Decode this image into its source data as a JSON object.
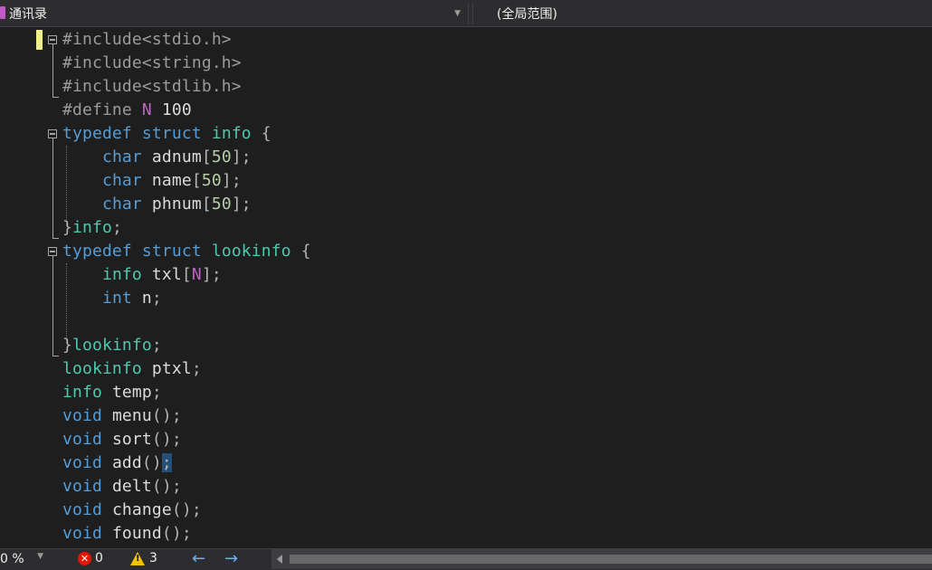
{
  "navbar": {
    "project": "通讯录",
    "scope": "(全局范围)"
  },
  "editor": {
    "lines": [
      [
        {
          "t": "#include",
          "c": "pp"
        },
        {
          "t": "<stdio.h>",
          "c": "pp"
        }
      ],
      [
        {
          "t": "#include",
          "c": "pp"
        },
        {
          "t": "<string.h>",
          "c": "pp"
        }
      ],
      [
        {
          "t": "#include",
          "c": "pp"
        },
        {
          "t": "<stdlib.h>",
          "c": "pp"
        }
      ],
      [
        {
          "t": "#define ",
          "c": "pp"
        },
        {
          "t": "N",
          "c": "mc"
        },
        {
          "t": " 100",
          "c": "pl"
        }
      ],
      [
        {
          "t": "typedef",
          "c": "kw"
        },
        {
          "t": " ",
          "c": "pl"
        },
        {
          "t": "struct",
          "c": "kw"
        },
        {
          "t": " ",
          "c": "pl"
        },
        {
          "t": "info",
          "c": "ty"
        },
        {
          "t": " {",
          "c": "pu"
        }
      ],
      [
        {
          "t": "    ",
          "c": "pl"
        },
        {
          "t": "char",
          "c": "kw"
        },
        {
          "t": " adnum",
          "c": "pl"
        },
        {
          "t": "[",
          "c": "pu"
        },
        {
          "t": "50",
          "c": "num"
        },
        {
          "t": "];",
          "c": "pu"
        }
      ],
      [
        {
          "t": "    ",
          "c": "pl"
        },
        {
          "t": "char",
          "c": "kw"
        },
        {
          "t": " name",
          "c": "pl"
        },
        {
          "t": "[",
          "c": "pu"
        },
        {
          "t": "50",
          "c": "num"
        },
        {
          "t": "];",
          "c": "pu"
        }
      ],
      [
        {
          "t": "    ",
          "c": "pl"
        },
        {
          "t": "char",
          "c": "kw"
        },
        {
          "t": " phnum",
          "c": "pl"
        },
        {
          "t": "[",
          "c": "pu"
        },
        {
          "t": "50",
          "c": "num"
        },
        {
          "t": "];",
          "c": "pu"
        }
      ],
      [
        {
          "t": "}",
          "c": "pu"
        },
        {
          "t": "info",
          "c": "ty"
        },
        {
          "t": ";",
          "c": "pu"
        }
      ],
      [
        {
          "t": "typedef",
          "c": "kw"
        },
        {
          "t": " ",
          "c": "pl"
        },
        {
          "t": "struct",
          "c": "kw"
        },
        {
          "t": " ",
          "c": "pl"
        },
        {
          "t": "lookinfo",
          "c": "ty"
        },
        {
          "t": " {",
          "c": "pu"
        }
      ],
      [
        {
          "t": "    ",
          "c": "pl"
        },
        {
          "t": "info",
          "c": "ty"
        },
        {
          "t": " txl",
          "c": "pl"
        },
        {
          "t": "[",
          "c": "pu"
        },
        {
          "t": "N",
          "c": "mc"
        },
        {
          "t": "];",
          "c": "pu"
        }
      ],
      [
        {
          "t": "    ",
          "c": "pl"
        },
        {
          "t": "int",
          "c": "kw"
        },
        {
          "t": " n",
          "c": "pl"
        },
        {
          "t": ";",
          "c": "pu"
        }
      ],
      [
        {
          "t": "",
          "c": "pl"
        }
      ],
      [
        {
          "t": "}",
          "c": "pu"
        },
        {
          "t": "lookinfo",
          "c": "ty"
        },
        {
          "t": ";",
          "c": "pu"
        }
      ],
      [
        {
          "t": "lookinfo",
          "c": "ty"
        },
        {
          "t": " ptxl",
          "c": "pl"
        },
        {
          "t": ";",
          "c": "pu"
        }
      ],
      [
        {
          "t": "info",
          "c": "ty"
        },
        {
          "t": " temp",
          "c": "pl"
        },
        {
          "t": ";",
          "c": "pu"
        }
      ],
      [
        {
          "t": "void",
          "c": "kw"
        },
        {
          "t": " menu",
          "c": "pl"
        },
        {
          "t": "();",
          "c": "pu"
        }
      ],
      [
        {
          "t": "void",
          "c": "kw"
        },
        {
          "t": " sort",
          "c": "pl"
        },
        {
          "t": "();",
          "c": "pu"
        }
      ],
      [
        {
          "t": "void",
          "c": "kw"
        },
        {
          "t": " add",
          "c": "pl"
        },
        {
          "t": "()",
          "c": "pu"
        },
        {
          "t": ";",
          "c": "pu hl"
        }
      ],
      [
        {
          "t": "void",
          "c": "kw"
        },
        {
          "t": " delt",
          "c": "pl"
        },
        {
          "t": "();",
          "c": "pu"
        }
      ],
      [
        {
          "t": "void",
          "c": "kw"
        },
        {
          "t": " change",
          "c": "pl"
        },
        {
          "t": "();",
          "c": "pu"
        }
      ],
      [
        {
          "t": "void",
          "c": "kw"
        },
        {
          "t": " found",
          "c": "pl"
        },
        {
          "t": "();",
          "c": "pu"
        }
      ]
    ]
  },
  "status": {
    "zoom": "0 %",
    "errors": "0",
    "warnings": "3",
    "error_glyph": "✕",
    "warning_glyph": "!",
    "back_arrow": "←",
    "forward_arrow": "→"
  },
  "colors": {
    "keyword": "#569cd6",
    "type": "#4ec9b0",
    "preprocessor": "#9b9b9b",
    "macro": "#bd63c5",
    "number": "#b5cea8"
  }
}
